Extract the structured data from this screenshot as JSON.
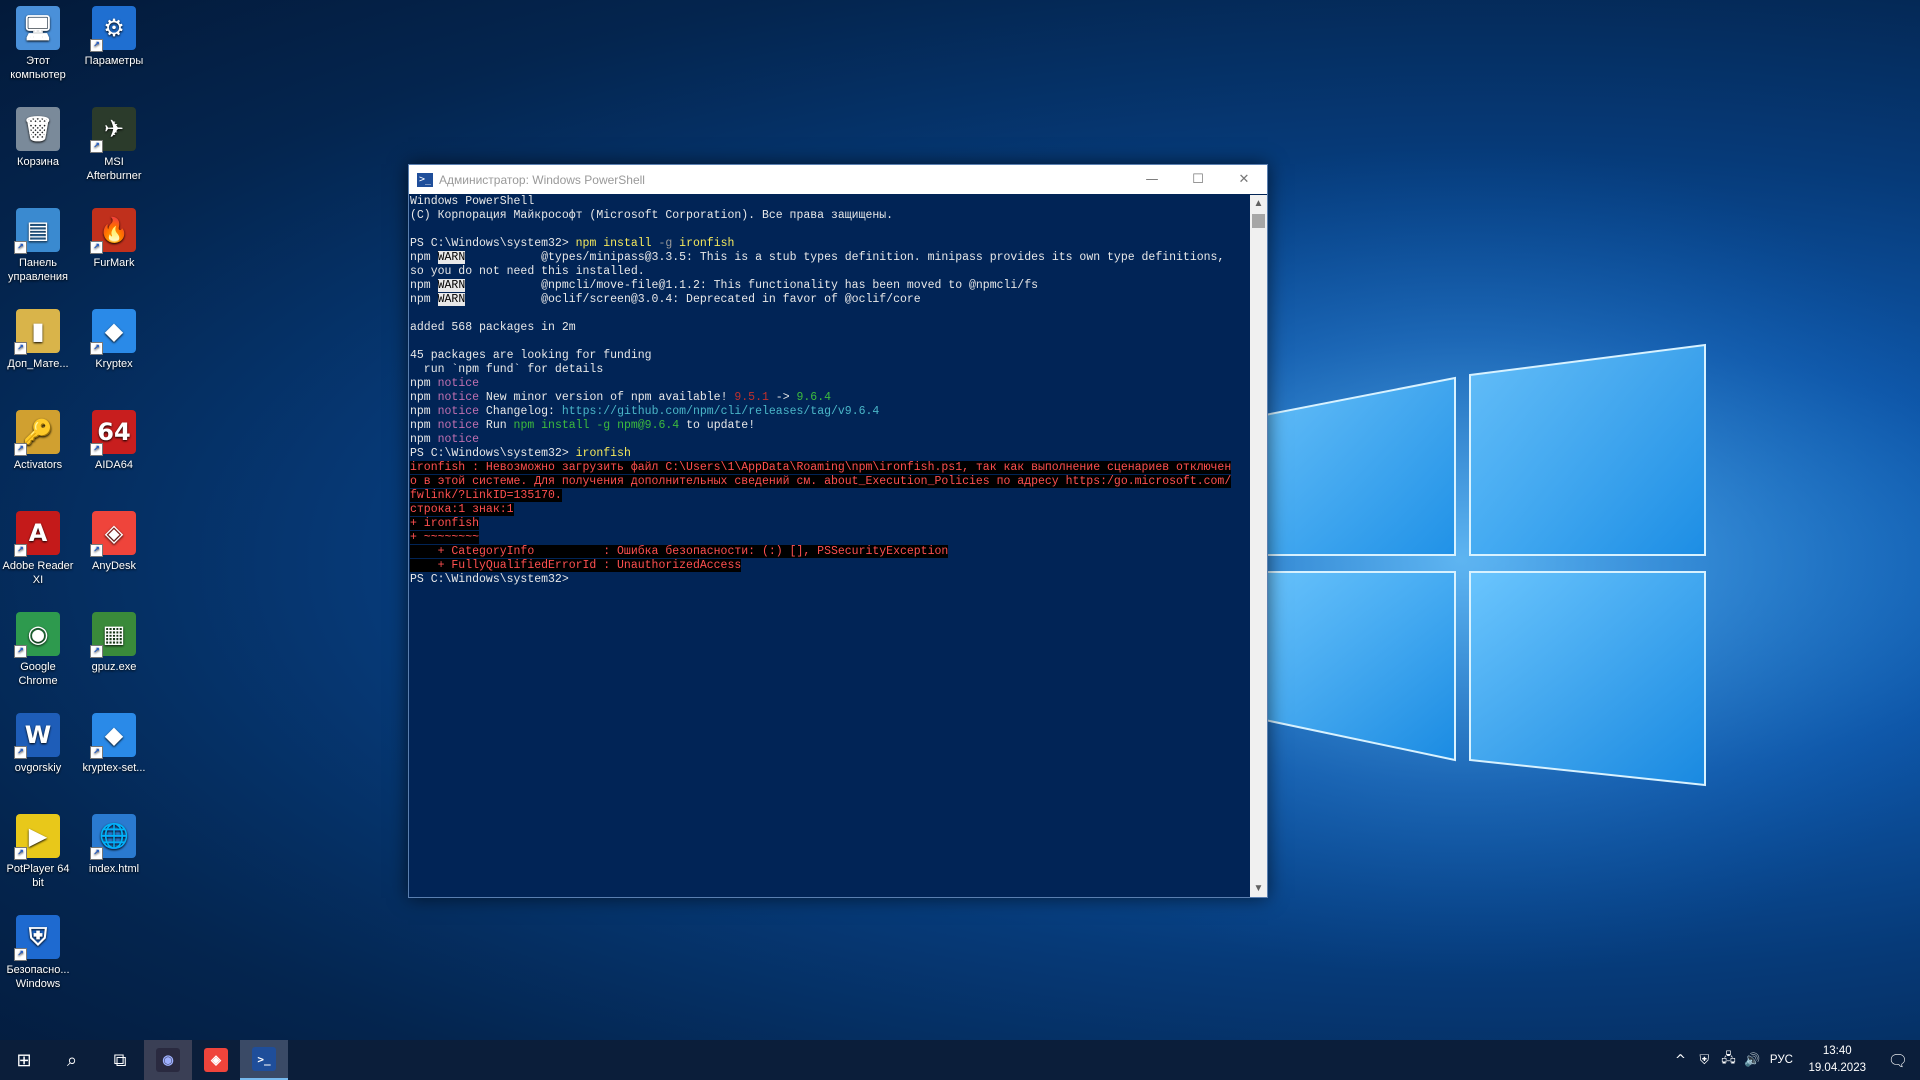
{
  "desktop": {
    "icons": [
      {
        "label": "Этот компьютер",
        "icon": "computer-icon",
        "color": "#4a90d9",
        "glyph": "🖥"
      },
      {
        "label": "Параметры",
        "icon": "gear-icon",
        "color": "#1f6fd1",
        "glyph": "⚙"
      },
      {
        "label": "Корзина",
        "icon": "recycle-bin-icon",
        "color": "#7a8a9a",
        "glyph": "🗑"
      },
      {
        "label": "MSI Afterburner",
        "icon": "msi-afterburner-icon",
        "color": "#2b3b2b",
        "glyph": "✈"
      },
      {
        "label": "Панель управления",
        "icon": "control-panel-icon",
        "color": "#3a8ad0",
        "glyph": "▤"
      },
      {
        "label": "FurMark",
        "icon": "furmark-icon",
        "color": "#c0301c",
        "glyph": "🔥"
      },
      {
        "label": "Доп_Мате...",
        "icon": "folder-icon",
        "color": "#d9b44a",
        "glyph": "▮"
      },
      {
        "label": "Kryptex",
        "icon": "kryptex-icon",
        "color": "#2a8ae8",
        "glyph": "◆"
      },
      {
        "label": "Activators",
        "icon": "activators-icon",
        "color": "#d0a030",
        "glyph": "🔑"
      },
      {
        "label": "AIDA64",
        "icon": "aida64-icon",
        "color": "#c81e1e",
        "glyph": "64"
      },
      {
        "label": "Adobe Reader XI",
        "icon": "adobe-reader-icon",
        "color": "#c41a1a",
        "glyph": "A"
      },
      {
        "label": "AnyDesk",
        "icon": "anydesk-icon",
        "color": "#ef443b",
        "glyph": "◈"
      },
      {
        "label": "Google Chrome",
        "icon": "chrome-icon",
        "color": "#2e9a4e",
        "glyph": "◉"
      },
      {
        "label": "gpuz.exe",
        "icon": "gpuz-icon",
        "color": "#3a8a3a",
        "glyph": "▦"
      },
      {
        "label": "ovgorskiy",
        "icon": "ovgorskiy-icon",
        "color": "#1e5db8",
        "glyph": "W"
      },
      {
        "label": "kryptex-set...",
        "icon": "kryptex-setup-icon",
        "color": "#2a8ae8",
        "glyph": "◆"
      },
      {
        "label": "PotPlayer 64 bit",
        "icon": "potplayer-icon",
        "color": "#e8c81a",
        "glyph": "▶"
      },
      {
        "label": "index.html",
        "icon": "globe-icon",
        "color": "#2a7ad0",
        "glyph": "🌐"
      },
      {
        "label": "Безопасно... Windows",
        "icon": "windows-security-icon",
        "color": "#1e6ad0",
        "glyph": "⛨"
      }
    ]
  },
  "window": {
    "title": "Администратор: Windows PowerShell",
    "minimize": "—",
    "maximize": "☐",
    "close": "✕"
  },
  "console": {
    "header1": "Windows PowerShell",
    "header2": "(С) Корпорация Майкрософт (Microsoft Corporation). Все права защищены.",
    "prompt": "PS C:\\Windows\\system32> ",
    "cmd1_a": "npm install ",
    "cmd1_b": "-g",
    "cmd1_c": " ironfish",
    "npm": "npm ",
    "warn": "WARN",
    "warn1": "           @types/minipass@3.3.5: This is a stub types definition. minipass provides its own type definitions,",
    "warn1b": "so you do not need this installed.",
    "warn2": "           @npmcli/move-file@1.1.2: This functionality has been moved to @npmcli/fs",
    "warn3": "           @oclif/screen@3.0.4: Deprecated in favor of @oclif/core",
    "added": "added 568 packages in 2m",
    "funding1": "45 packages are looking for funding",
    "funding2": "  run `npm fund` for details",
    "notice": "notice",
    "notice_new": " New minor version of npm available! ",
    "old_ver": "9.5.1",
    "arrow": " -> ",
    "new_ver": "9.6.4",
    "changelog_label": " Changelog: ",
    "changelog_url": "https://github.com/npm/cli/releases/tag/v9.6.4",
    "run_label": " Run ",
    "run_cmd": "npm install -g npm@9.6.4",
    "run_tail": " to update!",
    "cmd2": "ironfish",
    "err1": "ironfish : Невозможно загрузить файл C:\\Users\\1\\AppData\\Roaming\\npm\\ironfish.ps1, так как выполнение сценариев отключен",
    "err2": "о в этой системе. Для получения дополнительных сведений см. about_Execution_Policies по адресу https:/go.microsoft.com/",
    "err3": "fwlink/?LinkID=135170.",
    "err4": "строка:1 знак:1",
    "err5": "+ ironfish",
    "err6": "+ ~~~~~~~~",
    "err7": "    + CategoryInfo          : Ошибка безопасности: (:) [], PSSecurityException",
    "err8": "    + FullyQualifiedErrorId : UnauthorizedAccess"
  },
  "taskbar": {
    "start": "⊞",
    "search": "⌕",
    "taskview": "⧉",
    "language": "РУС",
    "time": "13:40",
    "date": "19.04.2023",
    "tray_expand": "^",
    "notifications": "🗨"
  },
  "colors": {
    "console_bg": "#012456",
    "taskbar_bg": "#0b1e3a"
  }
}
